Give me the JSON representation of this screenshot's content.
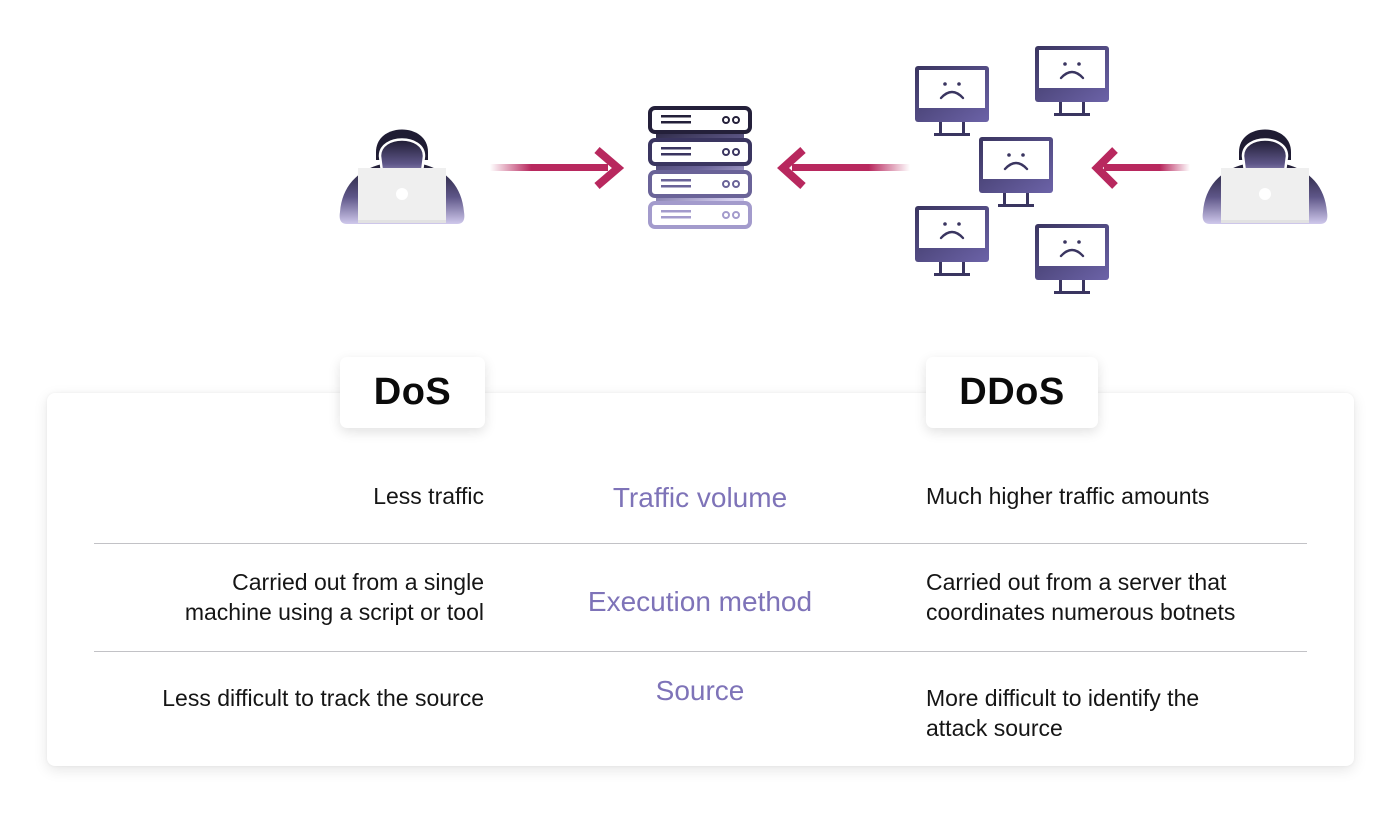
{
  "diagram": {
    "title_left": "DoS",
    "title_right": "DDoS",
    "colors": {
      "accent_purple": "#7e73b8",
      "arrow_crimson": "#b8285e",
      "icon_dark": "#2a2644",
      "icon_light": "#c9c2e6"
    },
    "illustration": {
      "dos": {
        "attacker_icon": "hacker-with-laptop-icon",
        "arrow_direction": "right",
        "target_icon": "server-rack-icon"
      },
      "ddos": {
        "attacker_icon": "hacker-with-laptop-icon",
        "arrow_to_botnet": "left",
        "botnet_icons": [
          "sad-monitor-icon",
          "sad-monitor-icon",
          "sad-monitor-icon",
          "sad-monitor-icon",
          "sad-monitor-icon"
        ],
        "arrow_to_server": "left"
      }
    },
    "rows": [
      {
        "criterion": "Traffic volume",
        "dos": [
          "Less traffic"
        ],
        "ddos": [
          "Much higher traffic amounts"
        ]
      },
      {
        "criterion": "Execution method",
        "dos": [
          "Carried out from a single",
          "machine using a script or tool"
        ],
        "ddos": [
          "Carried out from a server that",
          "coordinates numerous botnets"
        ]
      },
      {
        "criterion": "Source",
        "dos": [
          "Less difficult to track the source"
        ],
        "ddos": [
          "More difficult to identify the",
          "attack source"
        ]
      }
    ]
  }
}
